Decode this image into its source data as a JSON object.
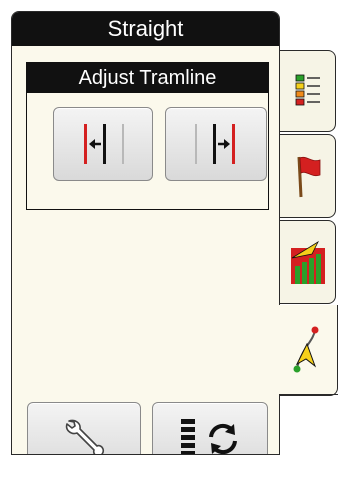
{
  "panel": {
    "title": "Straight",
    "group_title": "Adjust Tramline"
  },
  "buttons": [
    {
      "name": "shift-tramline-left-button",
      "icon": "shift-left-icon"
    },
    {
      "name": "shift-tramline-right-button",
      "icon": "shift-right-icon"
    },
    {
      "name": "settings-button",
      "icon": "wrench-icon"
    },
    {
      "name": "cycle-tramline-button",
      "icon": "cycle-tramline-icon"
    }
  ],
  "tabs": [
    {
      "name": "tab-list",
      "icon": "list-icon"
    },
    {
      "name": "tab-flag",
      "icon": "flag-icon"
    },
    {
      "name": "tab-field-chart",
      "icon": "field-chart-icon"
    },
    {
      "name": "tab-guidance",
      "icon": "guidance-path-icon",
      "active": true
    }
  ],
  "colors": {
    "panel_bg": "#fbf9ec",
    "header_bg": "#111111",
    "accent_red": "#d42020",
    "accent_green": "#2aa02a",
    "accent_yellow": "#f5d01a"
  }
}
